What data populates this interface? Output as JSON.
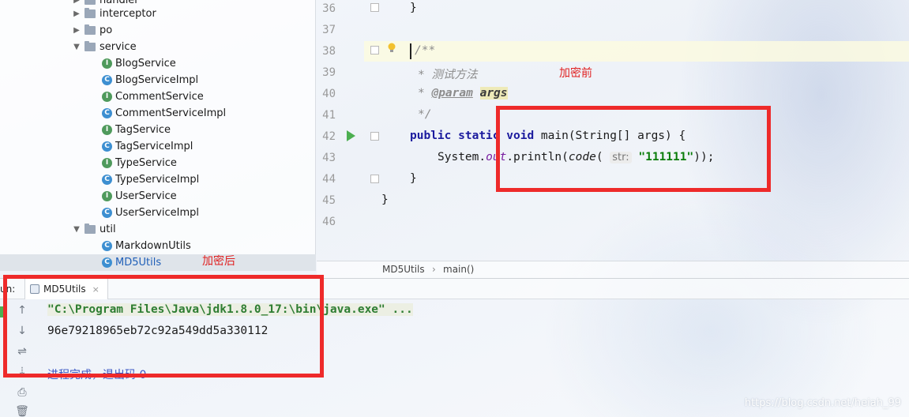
{
  "project_tree": {
    "items": [
      {
        "label": "handler",
        "kind": "folder",
        "expanded": false
      },
      {
        "label": "interceptor",
        "kind": "folder",
        "expanded": false
      },
      {
        "label": "po",
        "kind": "folder",
        "expanded": false
      },
      {
        "label": "service",
        "kind": "folder",
        "expanded": true
      },
      {
        "label": "BlogService",
        "kind": "interface"
      },
      {
        "label": "BlogServiceImpl",
        "kind": "class"
      },
      {
        "label": "CommentService",
        "kind": "interface"
      },
      {
        "label": "CommentServiceImpl",
        "kind": "class"
      },
      {
        "label": "TagService",
        "kind": "interface"
      },
      {
        "label": "TagServiceImpl",
        "kind": "class"
      },
      {
        "label": "TypeService",
        "kind": "interface"
      },
      {
        "label": "TypeServiceImpl",
        "kind": "class"
      },
      {
        "label": "UserService",
        "kind": "interface"
      },
      {
        "label": "UserServiceImpl",
        "kind": "class"
      },
      {
        "label": "util",
        "kind": "folder",
        "expanded": true
      },
      {
        "label": "MarkdownUtils",
        "kind": "class"
      },
      {
        "label": "MD5Utils",
        "kind": "class",
        "selected": true
      }
    ],
    "icon_letters": {
      "interface": "I",
      "class": "C"
    }
  },
  "editor": {
    "line_numbers": [
      "36",
      "37",
      "38",
      "39",
      "40",
      "41",
      "42",
      "43",
      "44",
      "45",
      "46"
    ],
    "code": {
      "l36_brace": "}",
      "l38_comment_open": "/**",
      "l39_comment": "* 测试方法",
      "l40_star": "* ",
      "l40_tag": "@param",
      "l40_arg": "args",
      "l41_comment_close": "*/",
      "l42_kw1": "public",
      "l42_kw2": "static",
      "l42_kw3": "void",
      "l42_rest": "main(String[] args) {",
      "l43_a": "System.",
      "l43_out": "out",
      "l43_b": ".println(",
      "l43_call": "code",
      "l43_paren": "( ",
      "l43_hint": "str:",
      "l43_str": "\"111111\"",
      "l43_end": "));",
      "l44_brace": "}",
      "l45_brace": "}"
    }
  },
  "breadcrumb": {
    "file": "MD5Utils",
    "sep": "›",
    "method": "main()"
  },
  "run_panel": {
    "label": "un:",
    "tab_label": "MD5Utils",
    "tab_close": "×",
    "console": {
      "command": "\"C:\\Program Files\\Java\\jdk1.8.0_17:\\bin\\java.exe\" ...",
      "output": "96e79218965eb72c92a549dd5a330112",
      "exit": "进程完成，退出码 0"
    }
  },
  "annotations": {
    "before_label": "加密前",
    "after_label": "加密后",
    "box_color": "#ee2a2a"
  },
  "watermark": "https://blog.csdn.net/heiah_99"
}
